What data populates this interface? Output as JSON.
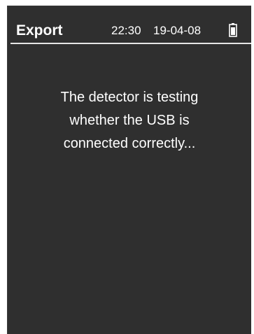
{
  "header": {
    "title": "Export",
    "time": "22:30",
    "date": "19-04-08",
    "battery_icon": "battery-icon"
  },
  "message": {
    "lines": [
      "The detector is testing",
      "whether the USB is",
      "connected correctly..."
    ]
  },
  "colors": {
    "screen_background": "#2f2f2f",
    "text": "#ffffff",
    "divider": "#e6e6e6"
  }
}
